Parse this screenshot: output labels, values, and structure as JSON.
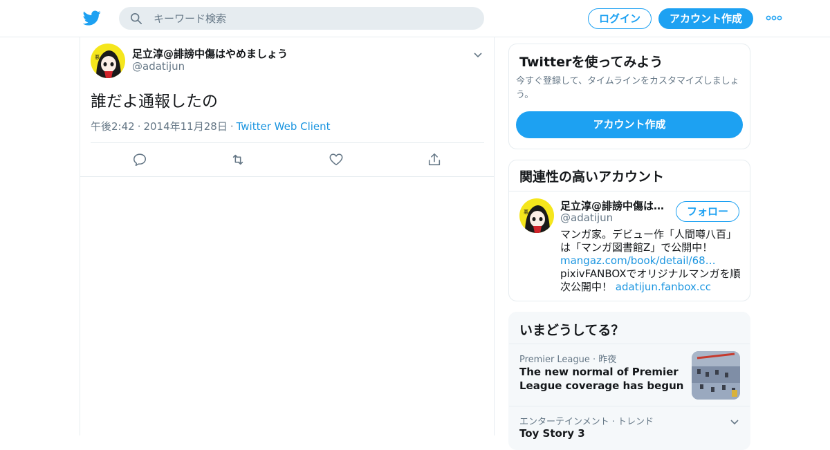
{
  "header": {
    "search_placeholder": "キーワード検索",
    "login_label": "ログイン",
    "signup_label": "アカウント作成"
  },
  "tweet": {
    "author_name": "足立淳@誹謗中傷はやめましょう",
    "author_handle": "@adatijun",
    "text": "誰だよ通報したの",
    "time": "午後2:42",
    "date": "2014年11月28日",
    "client": "Twitter Web Client",
    "separator": "·"
  },
  "signup_card": {
    "title": "Twitterを使ってみよう",
    "description": "今すぐ登録して、タイムラインをカスタマイズしましょう。",
    "button_label": "アカウント作成"
  },
  "related": {
    "title": "関連性の高いアカウント",
    "account_name": "足立淳@誹謗中傷は…",
    "account_handle": "@adatijun",
    "follow_label": "フォロー",
    "bio_line1": "マンガ家。デビュー作「人間噂八百」は「マンガ図書館Z」で公開中！",
    "bio_link1": "mangaz.com/book/detail/68…",
    "bio_line2": "pixivFANBOXでオリジナルマンガを順次公開中！",
    "bio_link2": "adatijun.fanbox.cc"
  },
  "trends": {
    "title": "いまどうしてる？",
    "items": [
      {
        "meta": "Premier League · 昨夜",
        "title": "The new normal of Premier League coverage has begun"
      },
      {
        "meta": "エンターテインメント · トレンド",
        "title": "Toy Story 3"
      }
    ]
  },
  "colors": {
    "accent": "#1da1f2",
    "link": "#1b95e0",
    "secondary_text": "#657786",
    "border": "#e6ecf0"
  }
}
